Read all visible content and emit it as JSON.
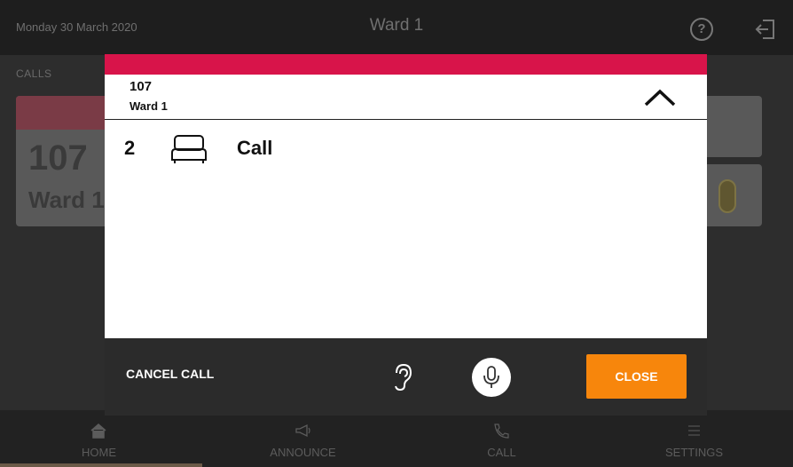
{
  "topbar": {
    "date": "Monday 30 March 2020",
    "title": "Ward 1",
    "help_symbol": "?",
    "help_icon": "help-circle-icon",
    "logout_icon": "logout-icon"
  },
  "background": {
    "calls_label": "CALLS",
    "card": {
      "room": "107",
      "ward": "Ward 1"
    }
  },
  "modal": {
    "accent_color": "#d8144a",
    "room": "107",
    "ward": "Ward 1",
    "collapse_icon": "chevron-up-icon",
    "calls": [
      {
        "bed": "2",
        "icon": "bed-icon",
        "type": "Call"
      }
    ],
    "footer": {
      "cancel_label": "CANCEL CALL",
      "listen_icon": "ear-icon",
      "mic_icon": "microphone-icon",
      "close_label": "CLOSE",
      "close_color": "#f7860c"
    }
  },
  "nav": {
    "items": [
      {
        "label": "HOME",
        "icon": "home-icon"
      },
      {
        "label": "ANNOUNCE",
        "icon": "megaphone-icon"
      },
      {
        "label": "CALL",
        "icon": "phone-icon"
      },
      {
        "label": "SETTINGS",
        "icon": "menu-icon"
      }
    ]
  }
}
